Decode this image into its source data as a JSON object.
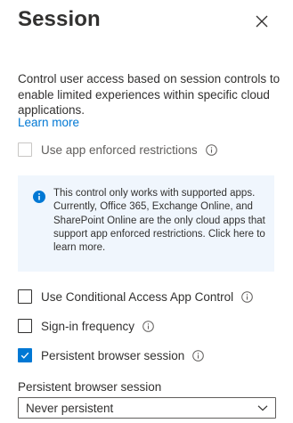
{
  "panel": {
    "title": "Session",
    "close_icon": "close-icon"
  },
  "description": "Control user access based on session controls to enable limited experiences within specific cloud applications.",
  "learn_more": "Learn more",
  "app_enforced": {
    "label": "Use app enforced restrictions",
    "checked": false,
    "disabled": true
  },
  "infobox": {
    "icon": "info-filled-icon",
    "text": "This control only works with supported apps. Currently, Office 365, Exchange Online, and SharePoint Online are the only cloud apps that support app enforced restrictions. Click here to learn more."
  },
  "options": [
    {
      "label": "Use Conditional Access App Control",
      "checked": false
    },
    {
      "label": "Sign-in frequency",
      "checked": false
    },
    {
      "label": "Persistent browser session",
      "checked": true
    }
  ],
  "persistent_session": {
    "label": "Persistent browser session",
    "selected": "Never persistent"
  },
  "colors": {
    "accent": "#0078d4",
    "infobox_bg": "#f0f6fd",
    "text": "#323130"
  }
}
